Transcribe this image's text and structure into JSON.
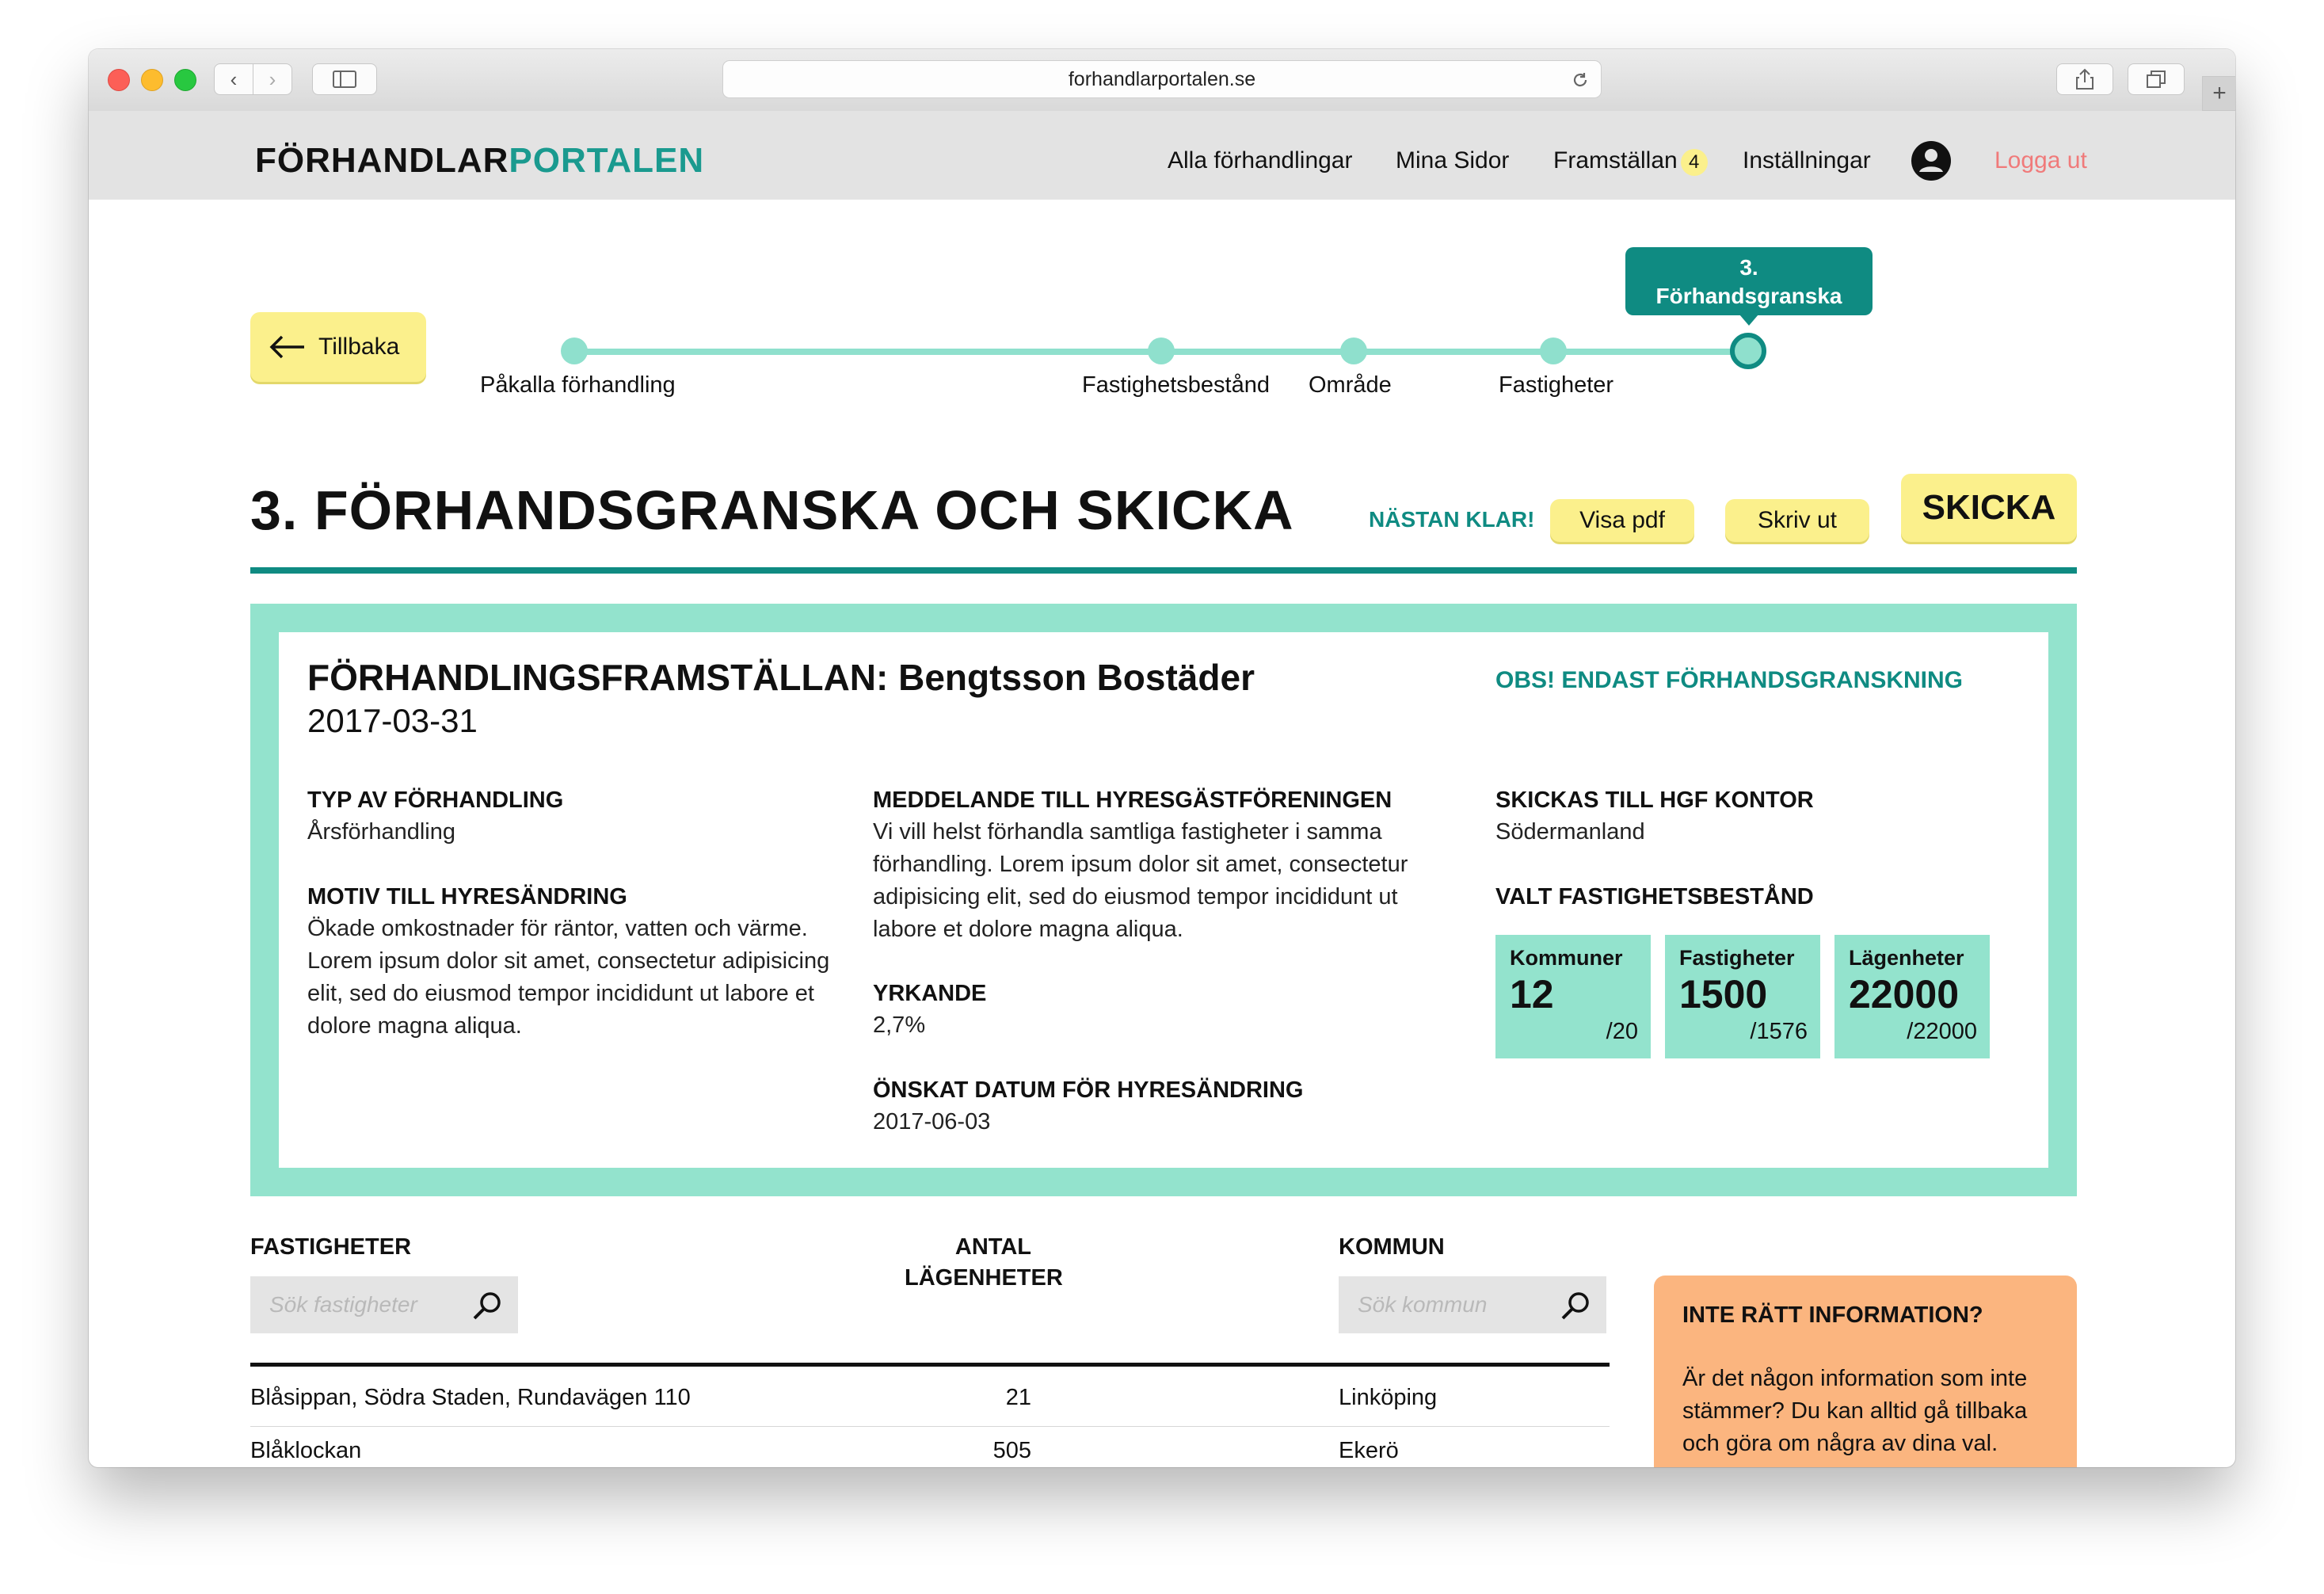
{
  "browser": {
    "url": "forhandlarportalen.se"
  },
  "site": {
    "logo_part1": "FÖRHANDLAR",
    "logo_part2": "PORTALEN",
    "nav": {
      "alla": "Alla förhandlingar",
      "mina": "Mina Sidor",
      "framstallan": "Framställan",
      "framstallan_count": "4",
      "installningar": "Inställningar",
      "logout": "Logga ut"
    }
  },
  "back_button": "Tillbaka",
  "steps": {
    "current_label": "3. Förhandsgranska & skicka",
    "labels": [
      "Påkalla förhandling",
      "Fastighetsbestånd",
      "Område",
      "Fastigheter"
    ]
  },
  "page": {
    "title": "3. FÖRHANDSGRANSKA OCH SKICKA",
    "status": "NÄSTAN KLAR!",
    "visa_pdf": "Visa pdf",
    "skriv_ut": "Skriv ut",
    "skicka": "SKICKA"
  },
  "preview": {
    "heading": "FÖRHANDLINGSFRAMSTÄLLAN: Bengtsson Bostäder",
    "date": "2017-03-31",
    "notice": "OBS! ENDAST FÖRHANDSGRANSKNING",
    "typ_title": "TYP AV FÖRHANDLING",
    "typ_value": "Årsförhandling",
    "motiv_title": "MOTIV TILL HYRESÄNDRING",
    "motiv_value": "Ökade omkostnader för räntor, vatten och värme. Lorem ipsum dolor sit amet, consectetur adipisicing elit, sed do eiusmod tempor incididunt ut labore et dolore magna aliqua.",
    "meddelande_title": "MEDDELANDE TILL HYRESGÄSTFÖRENINGEN",
    "meddelande_value": "Vi vill helst förhandla samtliga fastigheter i samma förhandling. Lorem ipsum dolor sit amet, consectetur adipisicing elit, sed do eiusmod tempor incididunt ut labore et dolore magna aliqua.",
    "yrkande_title": "YRKANDE",
    "yrkande_value": "2,7%",
    "datum_title": "ÖNSKAT DATUM FÖR HYRESÄNDRING",
    "datum_value": "2017-06-03",
    "kontor_title": "SKICKAS TILL HGF KONTOR",
    "kontor_value": "Södermanland",
    "bestand_title": "VALT FASTIGHETSBESTÅND",
    "stats": [
      {
        "label": "Kommuner",
        "value": "12",
        "total": "/20"
      },
      {
        "label": "Fastigheter",
        "value": "1500",
        "total": "/1576"
      },
      {
        "label": "Lägenheter",
        "value": "22000",
        "total": "/22000"
      }
    ]
  },
  "table": {
    "col_fastigheter": "FASTIGHETER",
    "col_antal_1": "ANTAL",
    "col_antal_2": "LÄGENHETER",
    "col_kommun": "KOMMUN",
    "search_fastigheter_placeholder": "Sök fastigheter",
    "search_kommun_placeholder": "Sök kommun",
    "rows": [
      {
        "name": "Blåsippan, Södra Staden, Rundavägen 110",
        "count": "21",
        "kommun": "Linköping"
      },
      {
        "name": "Blåklockan",
        "count": "505",
        "kommun": "Ekerö"
      }
    ]
  },
  "info_box": {
    "title": "INTE RÄTT INFORMATION?",
    "text": "Är det någon information som inte stämmer? Du kan alltid gå tillbaka och göra om några av dina val."
  },
  "colors": {
    "accent_teal": "#0f8b82",
    "mint": "#93e3cd",
    "yellow": "#fbf08c",
    "info_orange": "#fbb57f",
    "logout_red": "#f07a7a"
  }
}
